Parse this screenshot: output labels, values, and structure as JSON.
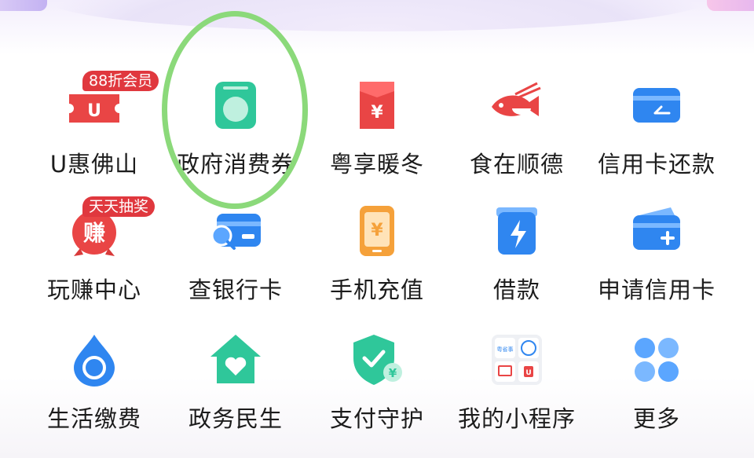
{
  "colors": {
    "red": "#e94545",
    "teal": "#2fc79a",
    "blue": "#2f86f0",
    "orange": "#f5a13a",
    "highlight": "#8bd97a"
  },
  "rows": [
    [
      {
        "label": "U惠佛山",
        "icon": "u-ticket-icon",
        "badge": "88折会员"
      },
      {
        "label": "政府消费券",
        "icon": "washing-machine-icon"
      },
      {
        "label": "粤享暖冬",
        "icon": "red-envelope-icon"
      },
      {
        "label": "食在顺德",
        "icon": "fish-chopsticks-icon"
      },
      {
        "label": "信用卡还款",
        "icon": "credit-card-repay-icon"
      }
    ],
    [
      {
        "label": "玩赚中心",
        "icon": "earn-icon",
        "badge": "天天抽奖",
        "icon_text": "赚"
      },
      {
        "label": "查银行卡",
        "icon": "bank-card-search-icon"
      },
      {
        "label": "手机充值",
        "icon": "phone-topup-icon"
      },
      {
        "label": "借款",
        "icon": "loan-lightning-icon"
      },
      {
        "label": "申请信用卡",
        "icon": "apply-credit-card-icon"
      }
    ],
    [
      {
        "label": "生活缴费",
        "icon": "water-drop-icon"
      },
      {
        "label": "政务民生",
        "icon": "house-heart-icon"
      },
      {
        "label": "支付守护",
        "icon": "shield-check-icon"
      },
      {
        "label": "我的小程序",
        "icon": "mini-programs-icon",
        "icon_text": "粤省事"
      },
      {
        "label": "更多",
        "icon": "clover-more-icon"
      }
    ]
  ]
}
